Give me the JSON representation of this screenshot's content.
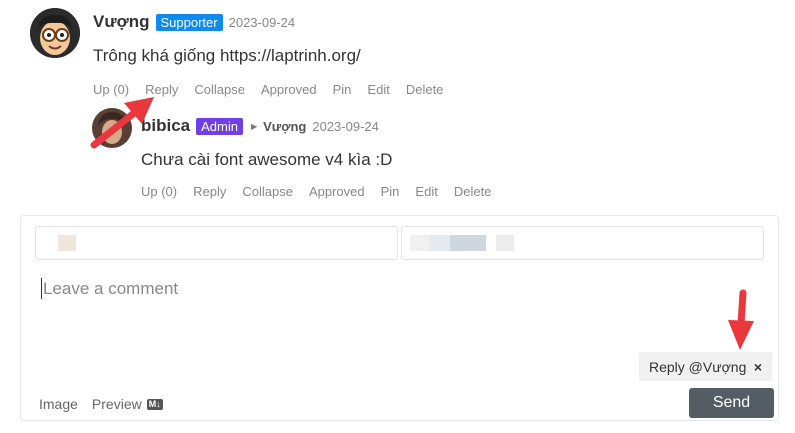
{
  "comment": {
    "author": "Vượng",
    "badge": "Supporter",
    "date": "2023-09-24",
    "content": "Trông khá giống https://laptrinh.org/",
    "actions": [
      "Up (0)",
      "Reply",
      "Collapse",
      "Approved",
      "Pin",
      "Edit",
      "Delete"
    ]
  },
  "reply": {
    "author": "bibica",
    "badge": "Admin",
    "reply_to": "Vượng",
    "date": "2023-09-24",
    "content": "Chưa cài font awesome v4 kìa :D",
    "actions": [
      "Up (0)",
      "Reply",
      "Collapse",
      "Approved",
      "Pin",
      "Edit",
      "Delete"
    ]
  },
  "editor": {
    "placeholder": "Leave a comment",
    "reply_chip": "Reply @Vượng",
    "chip_close": "×",
    "image_label": "Image",
    "preview_label": "Preview",
    "md_badge": "M↓",
    "send_label": "Send"
  },
  "colors": {
    "supporter": "#0d8bf0",
    "admin": "#6e40e6",
    "send": "#555d64",
    "annotation_arrow": "#e8383d"
  }
}
